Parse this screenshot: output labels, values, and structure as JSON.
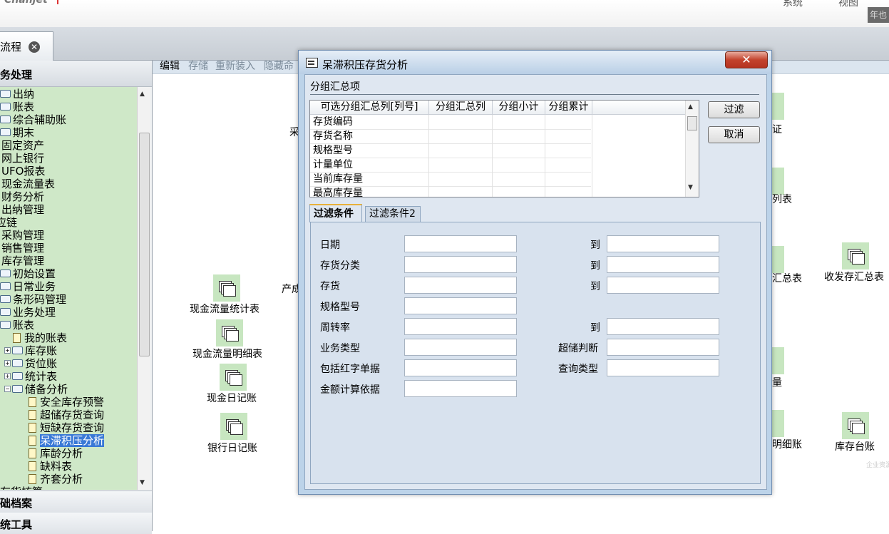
{
  "header": {
    "logo": "Chanjet",
    "menu_items": [
      "系统",
      "视图"
    ],
    "corner_text": "年也"
  },
  "tab": {
    "label": "流程",
    "close_icon": "close-icon"
  },
  "nav": {
    "header": "务处理",
    "tree": [
      {
        "label": "出纳",
        "icon": "folder-icon"
      },
      {
        "label": "账表",
        "icon": "folder-icon"
      },
      {
        "label": "综合辅助账",
        "icon": "folder-icon"
      },
      {
        "label": "期末",
        "icon": "folder-icon"
      },
      {
        "label": "固定资产",
        "icon": ""
      },
      {
        "label": "网上银行",
        "icon": ""
      },
      {
        "label": "UFO报表",
        "icon": ""
      },
      {
        "label": "现金流量表",
        "icon": ""
      },
      {
        "label": "财务分析",
        "icon": ""
      },
      {
        "label": "出纳管理",
        "icon": ""
      },
      {
        "label": "应链",
        "icon": ""
      },
      {
        "label": "采购管理",
        "icon": ""
      },
      {
        "label": "销售管理",
        "icon": ""
      },
      {
        "label": "库存管理",
        "icon": ""
      },
      {
        "label": "初始设置",
        "icon": "folder-icon"
      },
      {
        "label": "日常业务",
        "icon": "folder-icon"
      },
      {
        "label": "条形码管理",
        "icon": "folder-icon"
      },
      {
        "label": "业务处理",
        "icon": "folder-icon"
      },
      {
        "label": "账表",
        "icon": "folder-icon"
      },
      {
        "label": "我的账表",
        "icon": "document-icon"
      },
      {
        "label": "库存账",
        "icon": "folder-icon",
        "expander": "+"
      },
      {
        "label": "货位账",
        "icon": "folder-icon",
        "expander": "+"
      },
      {
        "label": "统计表",
        "icon": "folder-icon",
        "expander": "+"
      },
      {
        "label": "储备分析",
        "icon": "folder-icon",
        "expander": "−"
      },
      {
        "label": "安全库存预警",
        "icon": "document-icon"
      },
      {
        "label": "超储存货查询",
        "icon": "document-icon"
      },
      {
        "label": "短缺存货查询",
        "icon": "document-icon"
      },
      {
        "label": "呆滞积压分析",
        "icon": "document-icon",
        "selected": true
      },
      {
        "label": "库龄分析",
        "icon": "document-icon"
      },
      {
        "label": "缺料表",
        "icon": "document-icon"
      },
      {
        "label": "齐套分析",
        "icon": "document-icon"
      },
      {
        "label": "存货核算",
        "icon": ""
      }
    ],
    "footer_items": [
      "础档案",
      "统工具"
    ]
  },
  "workspace": {
    "toolbar": [
      "编辑",
      "存储",
      "重新装入",
      "隐藏命"
    ],
    "icons": [
      {
        "label": "现金流量统计表"
      },
      {
        "label": "现金流量明细表"
      },
      {
        "label": "现金日记账"
      },
      {
        "label": "银行日记账"
      },
      {
        "label": "收发存汇总表"
      },
      {
        "label": "库存台账"
      }
    ],
    "partial_labels": [
      "证",
      "列表",
      "汇总表",
      "量",
      "明细账",
      "采",
      "产成"
    ],
    "watermark": "企业资源"
  },
  "dialog": {
    "title": "呆滞积压存货分析",
    "close_label": "✕",
    "group_label": "分组汇总项",
    "grid_headers": [
      "可选分组汇总列[列号]",
      "分组汇总列",
      "分组小计",
      "分组累计"
    ],
    "grid_rows": [
      "存货编码",
      "存货名称",
      "规格型号",
      "计量单位",
      "当前库存量",
      "最高库存量"
    ],
    "buttons": {
      "filter": "过滤",
      "cancel": "取消"
    },
    "tabs": [
      "过滤条件",
      "过滤条件2"
    ],
    "to_label": "到",
    "fields_left": [
      "日期",
      "存货分类",
      "存货",
      "规格型号",
      "周转率",
      "业务类型",
      "包括红字单据",
      "金额计算依据"
    ],
    "fields_right": [
      "超储判断",
      "查询类型"
    ]
  }
}
